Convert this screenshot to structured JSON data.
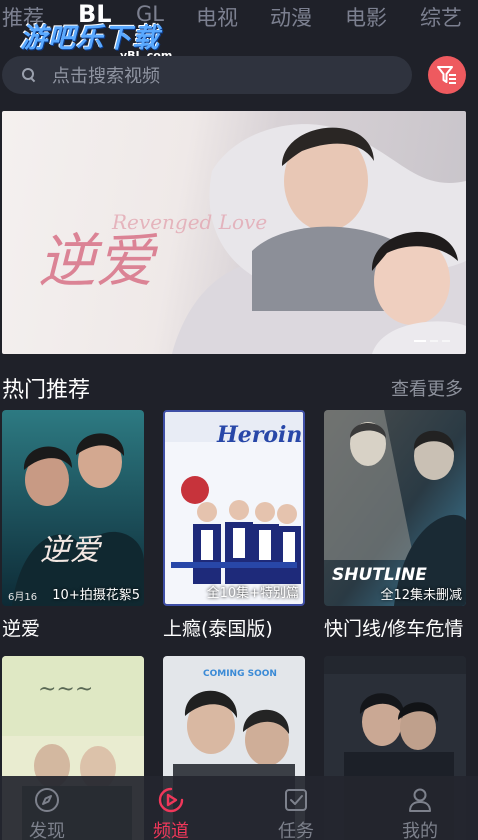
{
  "top_tabs": {
    "items": [
      {
        "label": "推荐"
      },
      {
        "label": "BL"
      },
      {
        "label": "GL"
      },
      {
        "label": "电视"
      },
      {
        "label": "动漫"
      },
      {
        "label": "电影"
      },
      {
        "label": "综艺"
      }
    ],
    "active_index": 1
  },
  "watermark": {
    "main": "游吧乐下载",
    "sub": "yBL.com"
  },
  "search": {
    "placeholder": "点击搜索视频",
    "icon": "search-icon"
  },
  "filter": {
    "icon": "filter-icon",
    "color": "#ee5a5f"
  },
  "banner": {
    "title_art": "逆爱",
    "title_art_en": "Revenged Love",
    "slide_count": 3,
    "active_slide": 0
  },
  "hot": {
    "title": "热门推荐",
    "more_label": "查看更多",
    "cards": [
      {
        "title": "逆爱",
        "badge": "10+拍摄花絮5",
        "poster_date": "6月16",
        "poster_art": "逆爱"
      },
      {
        "title": "上瘾(泰国版)",
        "badge": "全10集+特别篇",
        "poster_art": "Heroin"
      },
      {
        "title": "快门线/修车危情",
        "badge": "全12集未删减",
        "poster_art": "SHUTLINE"
      },
      {
        "title": "",
        "badge": "",
        "poster_art": ""
      },
      {
        "title": "",
        "badge": "",
        "poster_art": "COMING SOON"
      },
      {
        "title": "",
        "badge": "",
        "poster_art": ""
      }
    ]
  },
  "bottom_nav": {
    "items": [
      {
        "label": "发现",
        "icon": "compass-icon"
      },
      {
        "label": "频道",
        "icon": "play-icon"
      },
      {
        "label": "任务",
        "icon": "task-icon"
      },
      {
        "label": "我的",
        "icon": "user-icon"
      }
    ],
    "active_index": 1,
    "active_color": "#f0375a"
  }
}
